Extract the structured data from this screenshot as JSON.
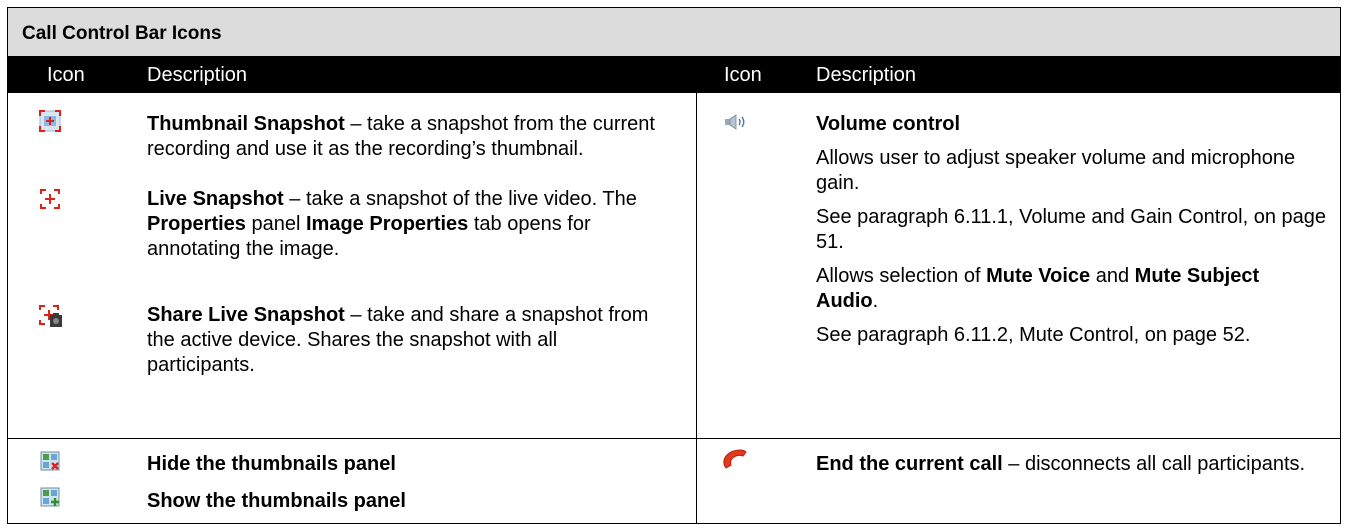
{
  "table": {
    "title": "Call Control Bar Icons",
    "headers": {
      "icon_left": "Icon",
      "desc_left": "Description",
      "icon_right": "Icon",
      "desc_right": "Description"
    }
  },
  "left": {
    "thumb_snapshot": {
      "bold": "Thumbnail Snapshot",
      "rest": " – take a snapshot from the current recording and use it as the recording’s thumbnail."
    },
    "live_snapshot": {
      "bold": "Live Snapshot",
      "mid1": " – take a snapshot of the live video. The ",
      "bold2": "Properties",
      "mid2": " panel ",
      "bold3": "Image Properties",
      "rest": " tab opens for annotating the image."
    },
    "share_snapshot": {
      "bold": "Share Live Snapshot",
      "rest": " – take and share a snapshot from the active device. Shares the snapshot with all participants."
    },
    "hide_thumbs": "Hide the thumbnails panel",
    "show_thumbs": "Show the thumbnails panel"
  },
  "right": {
    "volume_title": "Volume control",
    "volume_p1": "Allows user to adjust speaker volume and microphone gain.",
    "volume_p2": "See paragraph 6.11.1, Volume and Gain Control, on page 51.",
    "volume_p3_a": "Allows selection of ",
    "volume_p3_b": "Mute Voice",
    "volume_p3_c": " and ",
    "volume_p3_d": "Mute Subject Audio",
    "volume_p3_e": ".",
    "volume_p4": "See paragraph 6.11.2, Mute Control, on page 52.",
    "end_call_bold": "End the current call",
    "end_call_rest": " – disconnects all call participants."
  },
  "icons": {
    "thumbnail_snapshot": "thumbnail-snapshot-icon",
    "live_snapshot": "live-snapshot-icon",
    "share_live_snapshot": "share-live-snapshot-icon",
    "hide_thumbnails": "hide-thumbnails-icon",
    "show_thumbnails": "show-thumbnails-icon",
    "volume": "speaker-icon",
    "end_call": "phone-handset-icon"
  }
}
